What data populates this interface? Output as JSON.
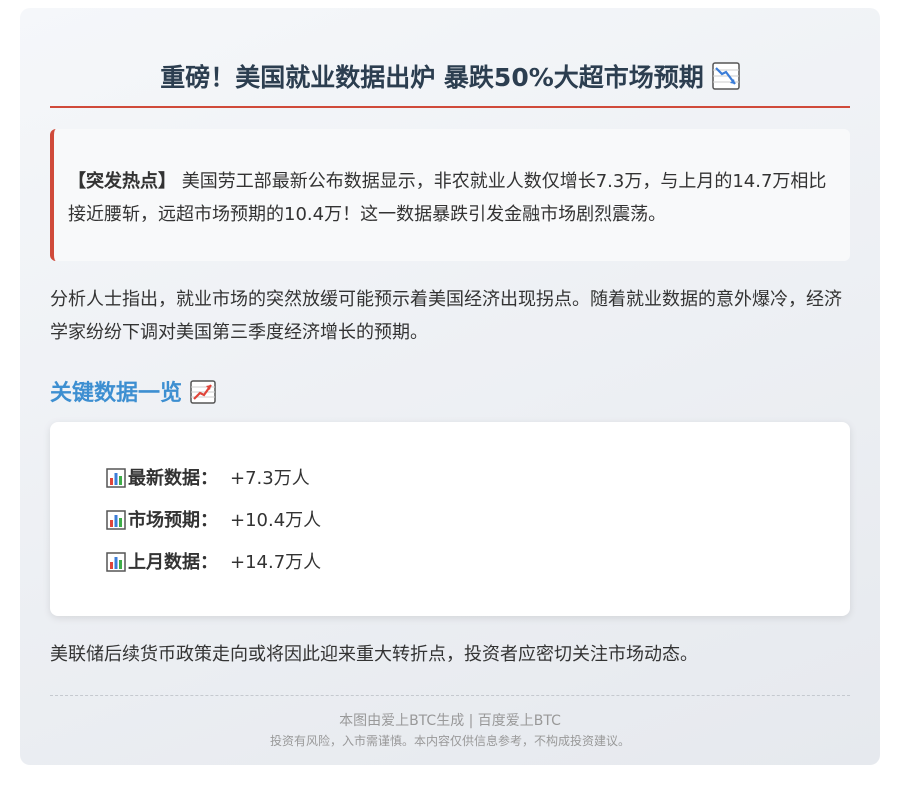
{
  "article": {
    "title": "重磅！美国就业数据出炉 暴跌50%大超市场预期",
    "title_icon": "chart-decreasing-icon",
    "alert": {
      "tag": "【突发热点】",
      "text": " 美国劳工部最新公布数据显示，非农就业人数仅增长7.3万，与上月的14.7万相比接近腰斩，远超市场预期的10.4万！这一数据暴跌引发金融市场剧烈震荡。"
    },
    "paragraph": "分析人士指出，就业市场的突然放缓可能预示着美国经济出现拐点。随着就业数据的意外爆冷，经济学家纷纷下调对美国第三季度经济增长的预期。",
    "key_data": {
      "heading": "关键数据一览",
      "heading_icon": "chart-increasing-icon",
      "rows": [
        {
          "icon": "bar-chart-icon",
          "label": "最新数据：",
          "value": "+7.3万人"
        },
        {
          "icon": "bar-chart-icon",
          "label": "市场预期：",
          "value": "+10.4万人"
        },
        {
          "icon": "bar-chart-icon",
          "label": "上月数据：",
          "value": "+14.7万人"
        }
      ]
    },
    "closing": "美联储后续货币政策走向或将因此迎来重大转折点，投资者应密切关注市场动态。",
    "footer": {
      "credit": "本图由爱上BTC生成 | 百度爱上BTC",
      "disclaimer": "投资有风险，入市需谨慎。本内容仅供信息参考，不构成投资建议。"
    }
  },
  "colors": {
    "accent_red": "#d04a3a",
    "title_color": "#2c3e50",
    "subhead_blue": "#3d8fd1"
  }
}
